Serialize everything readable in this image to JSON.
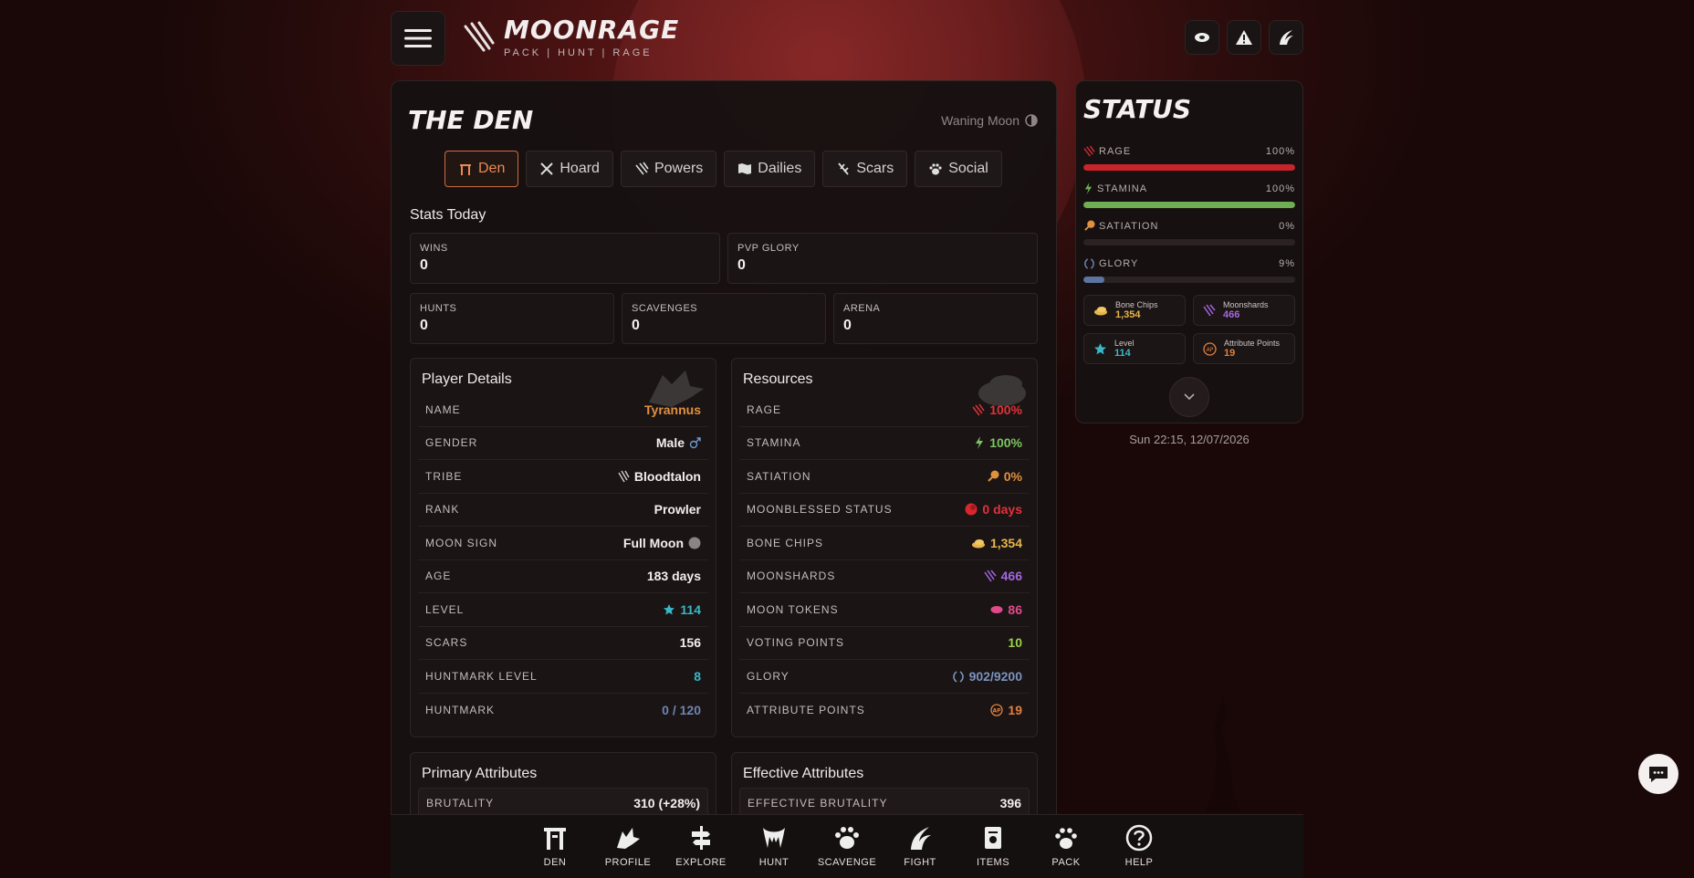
{
  "brand": {
    "title": "MOONRAGE",
    "subtitle": "PACK | HUNT | RAGE"
  },
  "main": {
    "title": "THE DEN",
    "moon_phase": "Waning Moon",
    "tabs": [
      {
        "label": "Den",
        "active": true
      },
      {
        "label": "Hoard"
      },
      {
        "label": "Powers"
      },
      {
        "label": "Dailies"
      },
      {
        "label": "Scars"
      },
      {
        "label": "Social"
      }
    ],
    "stats_title": "Stats Today",
    "stats": [
      {
        "label": "WINS",
        "value": "0"
      },
      {
        "label": "PVP GLORY",
        "value": "0"
      },
      {
        "label": "HUNTS",
        "value": "0"
      },
      {
        "label": "SCAVENGES",
        "value": "0"
      },
      {
        "label": "ARENA",
        "value": "0"
      }
    ],
    "player_details": {
      "title": "Player Details",
      "rows": [
        {
          "label": "NAME",
          "value": "Tyrannus",
          "color": "#e0913f"
        },
        {
          "label": "GENDER",
          "value": "Male",
          "icon": "male-symbol-icon"
        },
        {
          "label": "TRIBE",
          "value": "Bloodtalon",
          "icon": "claw-icon"
        },
        {
          "label": "RANK",
          "value": "Prowler"
        },
        {
          "label": "MOON SIGN",
          "value": "Full Moon",
          "icon": "full-moon-icon"
        },
        {
          "label": "AGE",
          "value": "183 days"
        },
        {
          "label": "LEVEL",
          "value": "114",
          "color": "#3ab7c7",
          "icon": "star-icon"
        },
        {
          "label": "SCARS",
          "value": "156"
        },
        {
          "label": "HUNTMARK LEVEL",
          "value": "8",
          "color": "#3ab7c7"
        },
        {
          "label": "HUNTMARK",
          "value": "0 / 120",
          "color": "#6e86b0"
        }
      ]
    },
    "resources": {
      "title": "Resources",
      "rows": [
        {
          "label": "RAGE",
          "value": "100%",
          "color": "#e0323a",
          "icon": "rage-claw-icon"
        },
        {
          "label": "STAMINA",
          "value": "100%",
          "color": "#7cc462",
          "icon": "lightning-icon"
        },
        {
          "label": "SATIATION",
          "value": "0%",
          "color": "#e0913f",
          "icon": "meat-icon"
        },
        {
          "label": "MOONBLESSED STATUS",
          "value": "0 days",
          "color": "#e0323a",
          "icon": "blood-moon-icon"
        },
        {
          "label": "BONE CHIPS",
          "value": "1,354",
          "color": "#e8b54a",
          "icon": "bone-chips-icon"
        },
        {
          "label": "MOONSHARDS",
          "value": "466",
          "color": "#a566e0",
          "icon": "moonshard-icon"
        },
        {
          "label": "MOON TOKENS",
          "value": "86",
          "color": "#e04a8a",
          "icon": "token-icon"
        },
        {
          "label": "VOTING POINTS",
          "value": "10",
          "color": "#9bd24a"
        },
        {
          "label": "GLORY",
          "value": "902/9200",
          "color": "#7a94c0",
          "icon": "laurel-icon"
        },
        {
          "label": "ATTRIBUTE POINTS",
          "value": "19",
          "color": "#e0803f",
          "icon": "ap-icon"
        }
      ]
    },
    "primary_attributes": {
      "title": "Primary Attributes",
      "first_label": "BRUTALITY",
      "first_value": "310 (+28%)"
    },
    "effective_attributes": {
      "title": "Effective Attributes",
      "first_label": "EFFECTIVE BRUTALITY",
      "first_value": "396"
    }
  },
  "status": {
    "title": "STATUS",
    "bars": [
      {
        "label": "RAGE",
        "value": "100%",
        "fraction": 1.0,
        "color": "#c8242c",
        "icon": "rage-claw-icon"
      },
      {
        "label": "STAMINA",
        "value": "100%",
        "fraction": 1.0,
        "color": "#6fae52",
        "icon": "lightning-icon"
      },
      {
        "label": "SATIATION",
        "value": "0%",
        "fraction": 0.0,
        "color": "#e0913f",
        "icon": "meat-icon"
      },
      {
        "label": "GLORY",
        "value": "9%",
        "fraction": 0.098,
        "color": "#5c74a0",
        "icon": "laurel-icon"
      }
    ],
    "minis": [
      {
        "label": "Bone Chips",
        "value": "1,354",
        "color": "#e8b54a",
        "icon": "bone-chips-icon"
      },
      {
        "label": "Moonshards",
        "value": "466",
        "color": "#a566e0",
        "icon": "moonshard-icon"
      },
      {
        "label": "Level",
        "value": "114",
        "color": "#3ab7c7",
        "icon": "star-icon"
      },
      {
        "label": "Attribute Points",
        "value": "19",
        "color": "#e0803f",
        "icon": "ap-icon"
      }
    ]
  },
  "timestamp": "Sun 22:15, 12/07/2026",
  "nav": [
    {
      "label": "DEN",
      "icon": "den-arch-icon"
    },
    {
      "label": "PROFILE",
      "icon": "wolf-head-icon"
    },
    {
      "label": "EXPLORE",
      "icon": "signpost-icon"
    },
    {
      "label": "HUNT",
      "icon": "fangs-icon"
    },
    {
      "label": "SCAVENGE",
      "icon": "scavenge-paw-icon"
    },
    {
      "label": "FIGHT",
      "icon": "claw-fist-icon"
    },
    {
      "label": "ITEMS",
      "icon": "scroll-icon"
    },
    {
      "label": "PACK",
      "icon": "paw-icon"
    },
    {
      "label": "HELP",
      "icon": "help-icon"
    }
  ]
}
